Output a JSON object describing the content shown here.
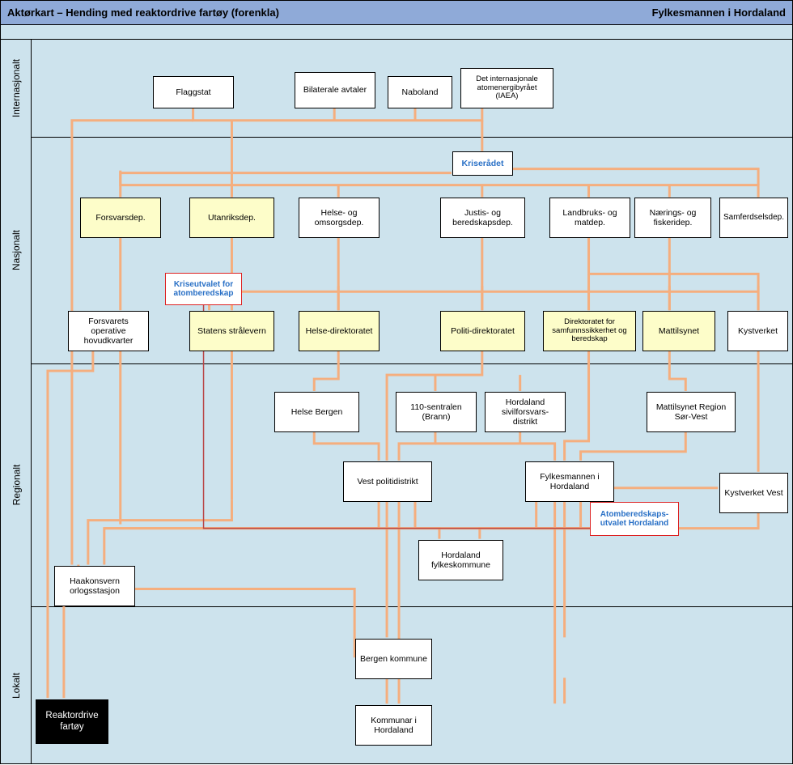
{
  "header": {
    "title": "Aktørkart – Hending med reaktordrive fartøy (forenkla)",
    "right": "Fylkesmannen i Hordaland"
  },
  "levels": {
    "intl": "Internasjonalt",
    "nat": "Nasjonalt",
    "reg": "Regionalt",
    "loc": "Lokalt"
  },
  "nodes": {
    "flagg": "Flaggstat",
    "bilat": "Bilaterale avtaler",
    "nabo": "Naboland",
    "iaea": "Det internasjonale atomenergibyrået (IAEA)",
    "krisrad": "Kriserådet",
    "forsvarsdep": "Forsvarsdep.",
    "utdep": "Utanriksdep.",
    "helsedep": "Helse- og omsorgsdep.",
    "justisdep": "Justis- og beredskapsdep.",
    "landdep": "Landbruks- og matdep.",
    "naerdep": "Nærings- og fiskeridep.",
    "samfdep": "Samferdselsdep.",
    "kua": "Kriseutvalet for atomberedskap",
    "fohk": "Forsvarets operative hovudkvarter",
    "stralevern": "Statens strålevern",
    "helsedir": "Helse-direktoratet",
    "poldir": "Politi-direktoratet",
    "dsb": "Direktoratet for samfunnssikkerhet og beredskap",
    "mattil": "Mattilsynet",
    "kystv": "Kystverket",
    "helsebergen": "Helse Bergen",
    "sentralen110": "110-sentralen (Brann)",
    "sivilforsvar": "Hordaland sivilforsvars-distrikt",
    "mattilsv": "Mattilsynet Region Sør-Vest",
    "vestpd": "Vest politidistrikt",
    "fylkesmann": "Fylkesmannen i Hordaland",
    "kystvest": "Kystverket Vest",
    "auh": "Atomberedskaps-utvalet Hordaland",
    "fylkeskom": "Hordaland fylkeskommune",
    "haakonsvern": "Haakonsvern orlogsstasjon",
    "bergenk": "Bergen kommune",
    "kommunar": "Kommunar i Hordaland",
    "fartoy": "Reaktordrive fartøy"
  }
}
